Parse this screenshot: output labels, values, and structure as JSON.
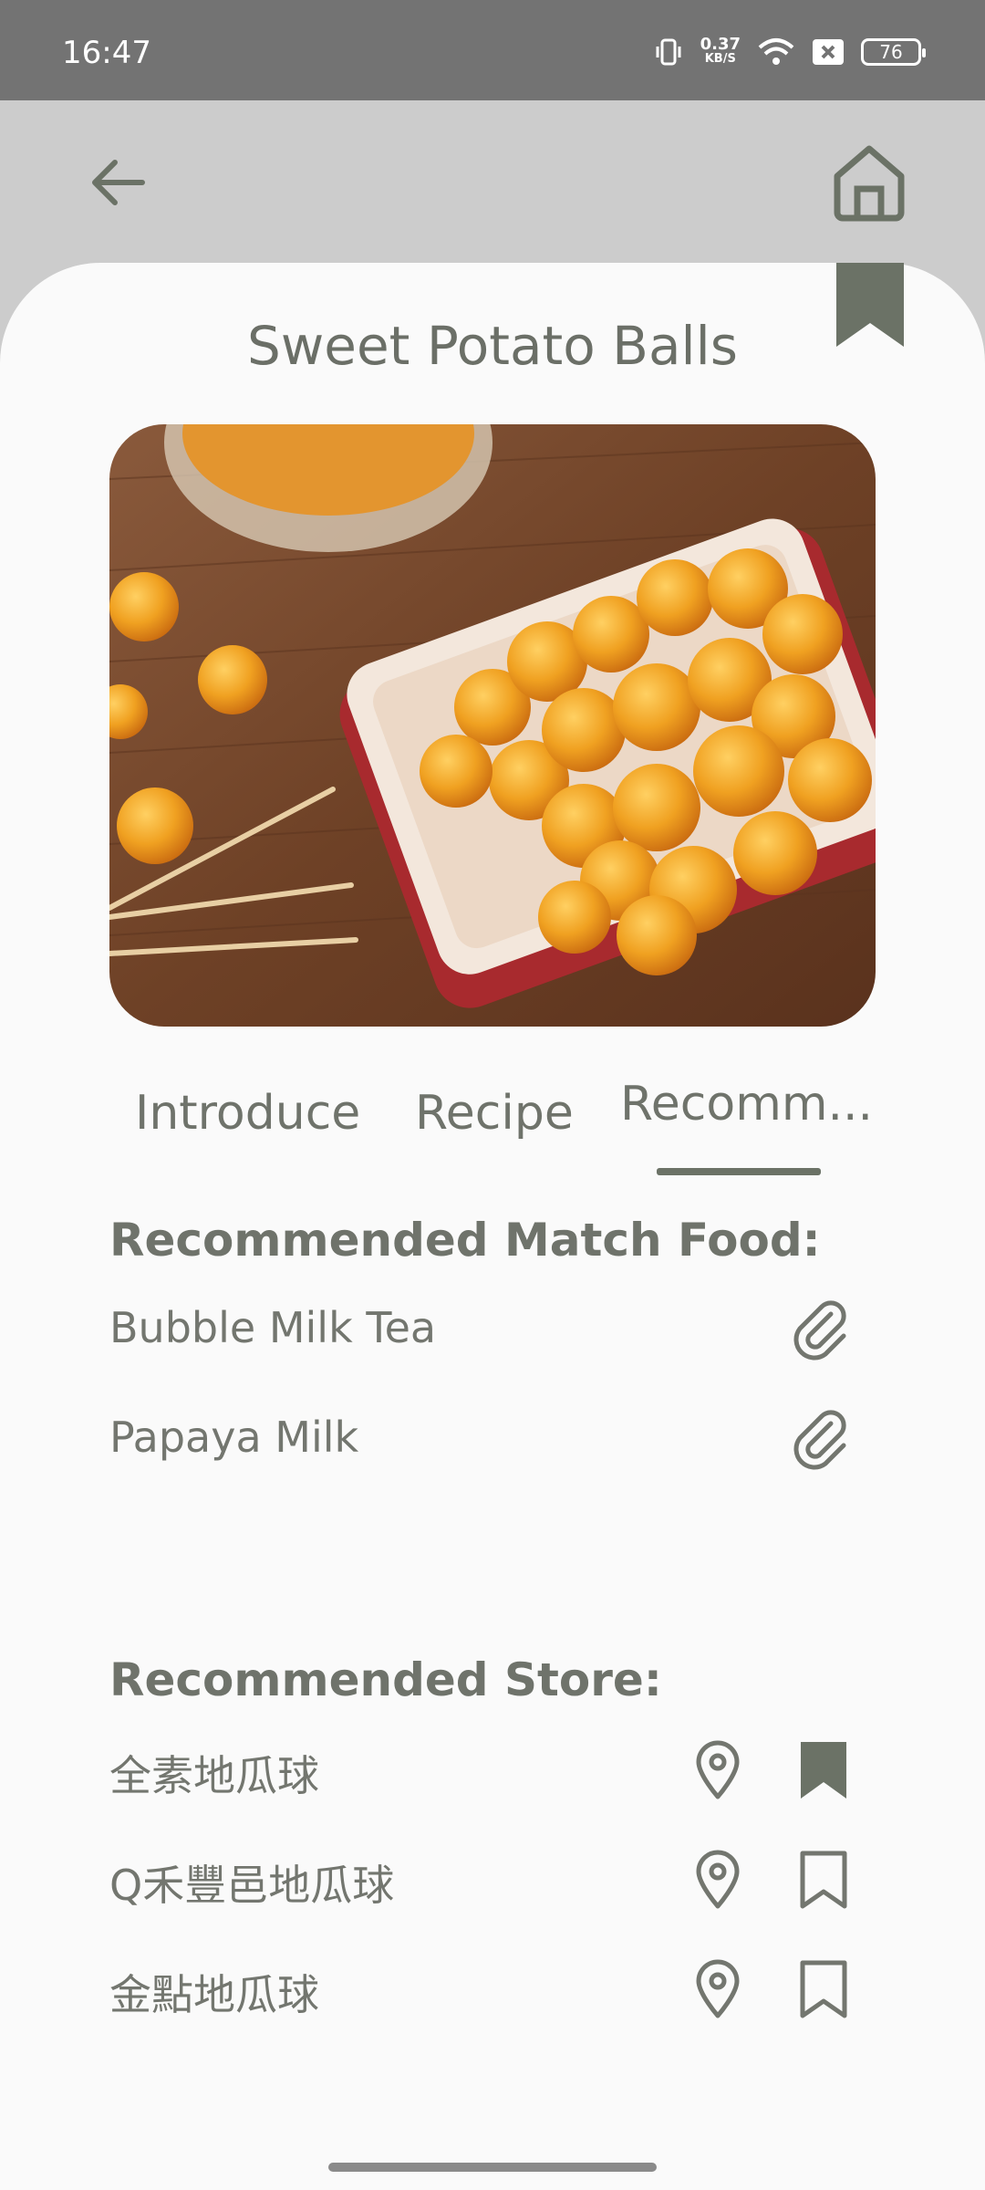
{
  "status_bar": {
    "time": "16:47",
    "net_speed_value": "0.37",
    "net_speed_unit": "KB/S",
    "battery": "76"
  },
  "header": {
    "back_icon": "arrow-left-icon",
    "home_icon": "home-icon"
  },
  "page": {
    "title": "Sweet Potato Balls",
    "bookmarked": true
  },
  "tabs": [
    {
      "label": "Introduce",
      "selected": false
    },
    {
      "label": "Recipe",
      "selected": false
    },
    {
      "label": "Recomm...",
      "selected": true
    }
  ],
  "match_food": {
    "heading": "Recommended Match Food:",
    "items": [
      {
        "name": "Bubble Milk Tea",
        "icon": "paperclip-icon"
      },
      {
        "name": "Papaya Milk",
        "icon": "paperclip-icon"
      }
    ]
  },
  "stores": {
    "heading": "Recommended Store:",
    "items": [
      {
        "name": "全素地瓜球",
        "bookmarked": true
      },
      {
        "name": "Q禾豐邑地瓜球",
        "bookmarked": false
      },
      {
        "name": "金點地瓜球",
        "bookmarked": false
      }
    ]
  },
  "colors": {
    "accent": "#6b7266",
    "text": "#73766f",
    "appbar": "#cccccc",
    "statusbar": "#737373"
  }
}
